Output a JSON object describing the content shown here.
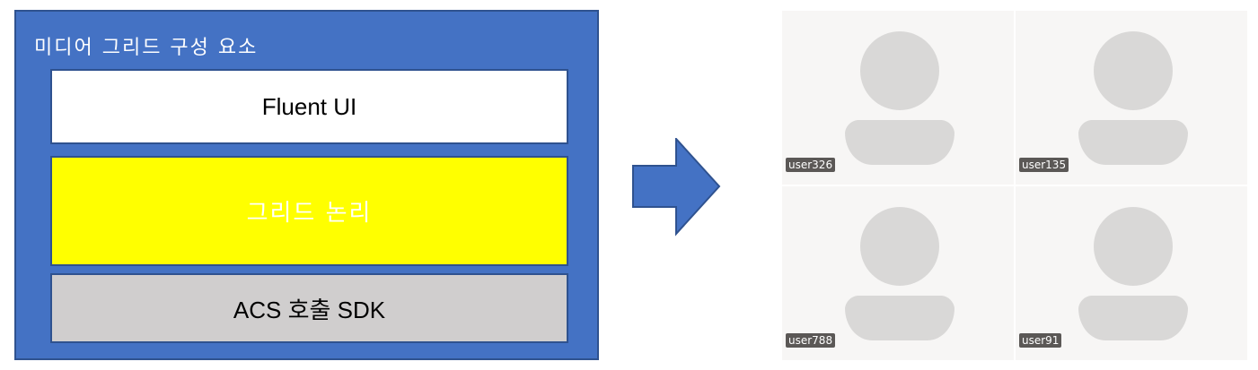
{
  "left_panel": {
    "title": "미디어 그리드 구성 요소",
    "layers": [
      {
        "label": "Fluent UI"
      },
      {
        "label": "그리드 논리"
      },
      {
        "label": "ACS 호출 SDK"
      }
    ]
  },
  "video_grid": {
    "tiles": [
      {
        "name": "user326"
      },
      {
        "name": "user135"
      },
      {
        "name": "user788"
      },
      {
        "name": "user91"
      }
    ]
  },
  "colors": {
    "panel_fill": "#4472c4",
    "panel_border": "#2f528f",
    "grid_logic_fill": "#ffff00",
    "sdk_fill": "#d0cece",
    "avatar_fill": "#d9d8d7",
    "tile_bg": "#f7f6f5"
  },
  "icons": {
    "arrow": "right-arrow-icon",
    "avatar": "person-avatar-icon"
  }
}
